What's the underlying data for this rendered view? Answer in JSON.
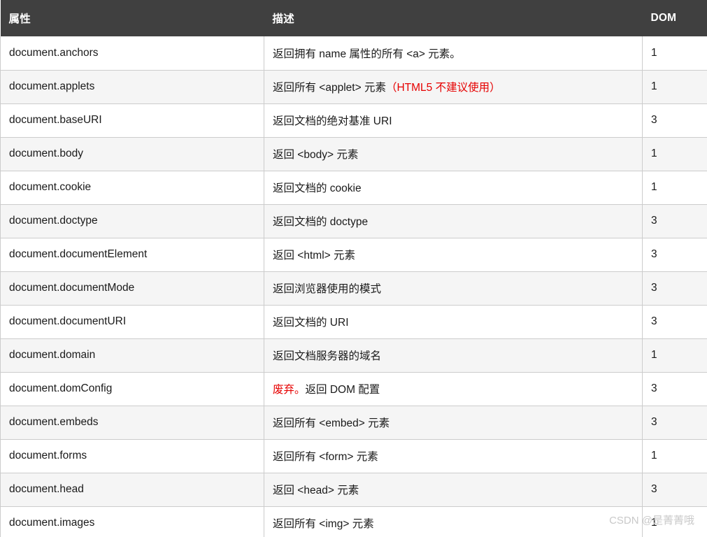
{
  "table": {
    "columns": [
      {
        "key": "attribute",
        "label": "属性"
      },
      {
        "key": "description",
        "label": "描述"
      },
      {
        "key": "dom",
        "label": "DOM"
      }
    ],
    "header_bg": "#404040",
    "header_fg": "#ffffff",
    "stripe_bg": "#f5f5f5",
    "border_color": "#cccccc",
    "warn_color": "#e60000",
    "rows": [
      {
        "attribute": "document.anchors",
        "description_parts": [
          {
            "text": "返回拥有 name 属性的所有 <a> 元素。",
            "style": "normal"
          }
        ],
        "dom": "1"
      },
      {
        "attribute": "document.applets",
        "description_parts": [
          {
            "text": "返回所有 <applet> 元素",
            "style": "normal"
          },
          {
            "text": "（HTML5 不建议使用）",
            "style": "warn"
          }
        ],
        "dom": "1"
      },
      {
        "attribute": "document.baseURI",
        "description_parts": [
          {
            "text": "返回文档的绝对基准 URI",
            "style": "normal"
          }
        ],
        "dom": "3"
      },
      {
        "attribute": "document.body",
        "description_parts": [
          {
            "text": "返回 <body> 元素",
            "style": "normal"
          }
        ],
        "dom": "1"
      },
      {
        "attribute": "document.cookie",
        "description_parts": [
          {
            "text": "返回文档的 cookie",
            "style": "normal"
          }
        ],
        "dom": "1"
      },
      {
        "attribute": "document.doctype",
        "description_parts": [
          {
            "text": "返回文档的 doctype",
            "style": "normal"
          }
        ],
        "dom": "3"
      },
      {
        "attribute": "document.documentElement",
        "description_parts": [
          {
            "text": "返回 <html> 元素",
            "style": "normal"
          }
        ],
        "dom": "3"
      },
      {
        "attribute": "document.documentMode",
        "description_parts": [
          {
            "text": "返回浏览器使用的模式",
            "style": "normal"
          }
        ],
        "dom": "3"
      },
      {
        "attribute": "document.documentURI",
        "description_parts": [
          {
            "text": "返回文档的 URI",
            "style": "normal"
          }
        ],
        "dom": "3"
      },
      {
        "attribute": "document.domain",
        "description_parts": [
          {
            "text": "返回文档服务器的域名",
            "style": "normal"
          }
        ],
        "dom": "1"
      },
      {
        "attribute": "document.domConfig",
        "description_parts": [
          {
            "text": "废弃。",
            "style": "warn"
          },
          {
            "text": "返回 DOM 配置",
            "style": "normal"
          }
        ],
        "dom": "3"
      },
      {
        "attribute": "document.embeds",
        "description_parts": [
          {
            "text": "返回所有 <embed> 元素",
            "style": "normal"
          }
        ],
        "dom": "3"
      },
      {
        "attribute": "document.forms",
        "description_parts": [
          {
            "text": "返回所有 <form> 元素",
            "style": "normal"
          }
        ],
        "dom": "1"
      },
      {
        "attribute": "document.head",
        "description_parts": [
          {
            "text": "返回 <head> 元素",
            "style": "normal"
          }
        ],
        "dom": "3"
      },
      {
        "attribute": "document.images",
        "description_parts": [
          {
            "text": "返回所有 <img> 元素",
            "style": "normal"
          }
        ],
        "dom": "1"
      }
    ]
  },
  "watermark": {
    "text": "CSDN @是菁菁哦"
  }
}
